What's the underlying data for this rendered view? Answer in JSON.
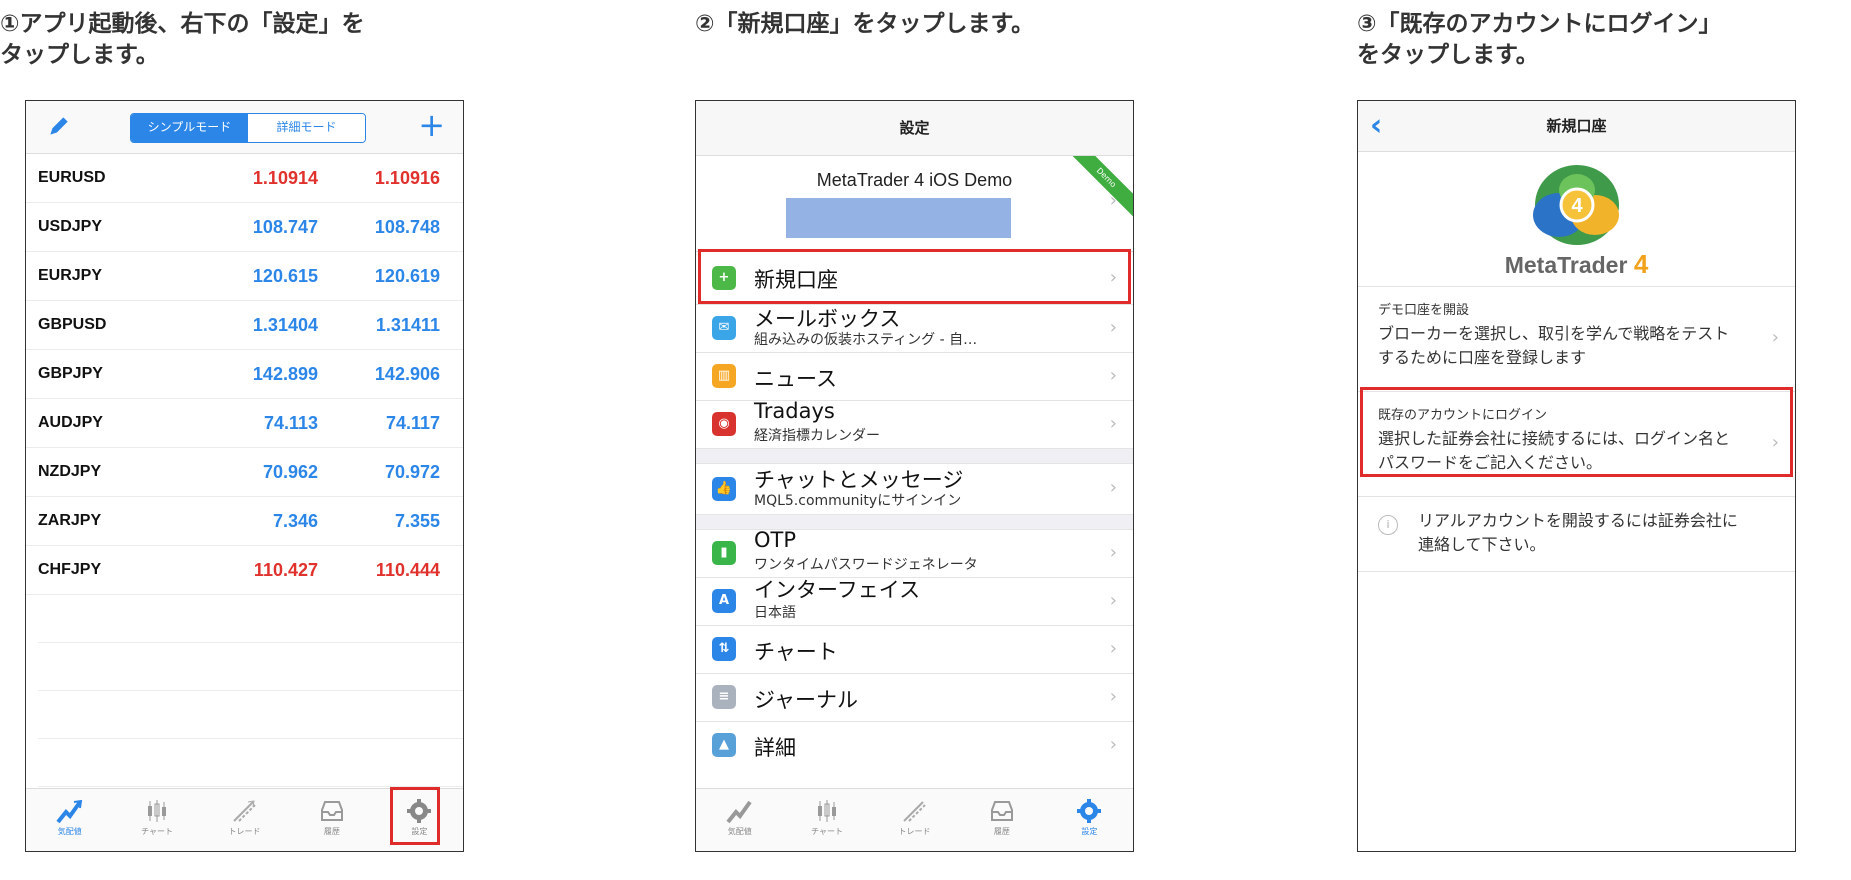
{
  "steps": [
    {
      "title": "①アプリ起動後、右下の「設定」を\nタップします。"
    },
    {
      "title": "②「新規口座」をタップします。"
    },
    {
      "title": "③「既存のアカウントにログイン」\nをタップします。"
    }
  ],
  "phone1": {
    "segment": {
      "simple": "シンプルモード",
      "detail": "詳細モード"
    },
    "plus": "+",
    "quotes": [
      {
        "symbol": "EURUSD",
        "bid": "1.10914",
        "ask": "1.10916",
        "color": "#e0312d"
      },
      {
        "symbol": "USDJPY",
        "bid": "108.747",
        "ask": "108.748",
        "color": "#2c86e8"
      },
      {
        "symbol": "EURJPY",
        "bid": "120.615",
        "ask": "120.619",
        "color": "#2c86e8"
      },
      {
        "symbol": "GBPUSD",
        "bid": "1.31404",
        "ask": "1.31411",
        "color": "#2c86e8"
      },
      {
        "symbol": "GBPJPY",
        "bid": "142.899",
        "ask": "142.906",
        "color": "#2c86e8"
      },
      {
        "symbol": "AUDJPY",
        "bid": "74.113",
        "ask": "74.117",
        "color": "#2c86e8"
      },
      {
        "symbol": "NZDJPY",
        "bid": "70.962",
        "ask": "70.972",
        "color": "#2c86e8"
      },
      {
        "symbol": "ZARJPY",
        "bid": "7.346",
        "ask": "7.355",
        "color": "#2c86e8"
      },
      {
        "symbol": "CHFJPY",
        "bid": "110.427",
        "ask": "110.444",
        "color": "#e0312d"
      }
    ],
    "tabs": [
      "気配値",
      "チャート",
      "トレード",
      "履歴",
      "設定"
    ]
  },
  "phone2": {
    "nav_title": "設定",
    "account_name": "MetaTrader 4 iOS Demo",
    "ribbon": "Demo",
    "rows": {
      "new_account": "新規口座",
      "mailbox": "メールボックス",
      "mailbox_sub": "組み込みの仮装ホスティング - 自…",
      "news": "ニュース",
      "tradays": "Tradays",
      "tradays_sub": "経済指標カレンダー",
      "chat": "チャットとメッセージ",
      "chat_sub": "MQL5.communityにサインイン",
      "otp": "OTP",
      "otp_sub": "ワンタイムパスワードジェネレータ",
      "interface": "インターフェイス",
      "interface_sub": "日本語",
      "chart": "チャート",
      "journal": "ジャーナル",
      "detail": "詳細"
    },
    "tabs": [
      "気配値",
      "チャート",
      "トレード",
      "履歴",
      "設定"
    ]
  },
  "phone3": {
    "nav_title": "新規口座",
    "logo_text": "MetaTrader",
    "logo_num": "4",
    "demo_head": "デモ口座を開設",
    "demo_body": "ブローカーを選択し、取引を学んで戦略をテストするために口座を登録します",
    "login_head": "既存のアカウントにログイン",
    "login_body": "選択した証券会社に接続するには、ログイン名とパスワードをご記入ください。",
    "info": "リアルアカウントを開設するには証券会社に連絡して下さい。"
  },
  "colors": {
    "accent": "#2c86e8",
    "highlight": "#e02b2b",
    "bid_up": "#2c86e8",
    "bid_down": "#e0312d"
  }
}
